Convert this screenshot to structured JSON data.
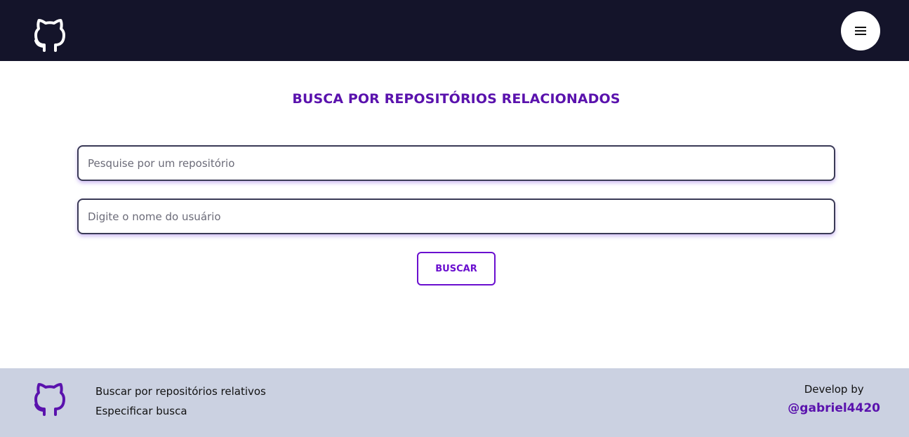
{
  "header": {
    "logo_icon": "github-icon",
    "menu_icon": "hamburger-menu-icon",
    "colors": {
      "background": "#14142a",
      "logo": "#ffffff"
    }
  },
  "main": {
    "title": "BUSCA POR REPOSITÓRIOS RELACIONADOS",
    "repo_input": {
      "placeholder": "Pesquise por um repositório",
      "value": ""
    },
    "user_input": {
      "placeholder": "Digite o nome do usuário",
      "value": ""
    },
    "search_button_label": "BUSCAR",
    "colors": {
      "accent": "#5a12ad",
      "button": "#6a0fcf"
    }
  },
  "footer": {
    "logo_icon": "github-icon",
    "links": [
      "Buscar por repositórios relativos",
      "Especificar busca"
    ],
    "credit_label": "Develop by",
    "credit_handle": "@gabriel4420",
    "colors": {
      "background": "#cbd1e1",
      "logo": "#5a12ad"
    }
  }
}
